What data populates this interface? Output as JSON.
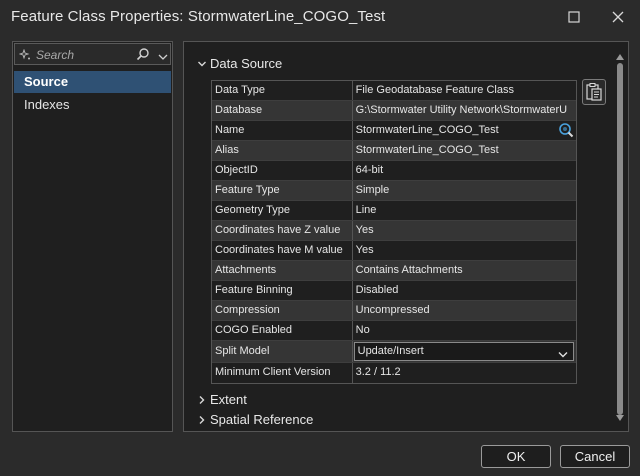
{
  "window": {
    "title": "Feature Class Properties: StormwaterLine_COGO_Test",
    "maximize_icon": "maximize-icon",
    "close_icon": "close-icon"
  },
  "sidebar": {
    "search_placeholder": "Search",
    "items": [
      {
        "label": "Source",
        "active": true
      },
      {
        "label": "Indexes",
        "active": false
      }
    ]
  },
  "main": {
    "sections": [
      {
        "label": "Data Source",
        "expanded": true
      },
      {
        "label": "Extent",
        "expanded": false
      },
      {
        "label": "Spatial Reference",
        "expanded": false
      }
    ],
    "properties": [
      {
        "key": "Data Type",
        "value": "File Geodatabase Feature Class"
      },
      {
        "key": "Database",
        "value": "G:\\Stormwater Utility Network\\StormwaterU"
      },
      {
        "key": "Name",
        "value": "StormwaterLine_COGO_Test"
      },
      {
        "key": "Alias",
        "value": "StormwaterLine_COGO_Test"
      },
      {
        "key": "ObjectID",
        "value": "64-bit"
      },
      {
        "key": "Feature Type",
        "value": "Simple"
      },
      {
        "key": "Geometry Type",
        "value": "Line"
      },
      {
        "key": "Coordinates have Z value",
        "value": "Yes"
      },
      {
        "key": "Coordinates have M value",
        "value": "Yes"
      },
      {
        "key": "Attachments",
        "value": "Contains Attachments"
      },
      {
        "key": "Feature Binning",
        "value": "Disabled"
      },
      {
        "key": "Compression",
        "value": "Uncompressed"
      },
      {
        "key": "COGO Enabled",
        "value": "No"
      },
      {
        "key": "Split Model",
        "value": "Update/Insert"
      },
      {
        "key": "Minimum Client Version",
        "value": "3.2 / 11.2"
      }
    ]
  },
  "buttons": {
    "ok": "OK",
    "cancel": "Cancel"
  },
  "colors": {
    "background": "#2b2b2b",
    "panel": "#1f1f1f",
    "selected": "#2f5174",
    "accent_icon": "#4aa3df"
  }
}
